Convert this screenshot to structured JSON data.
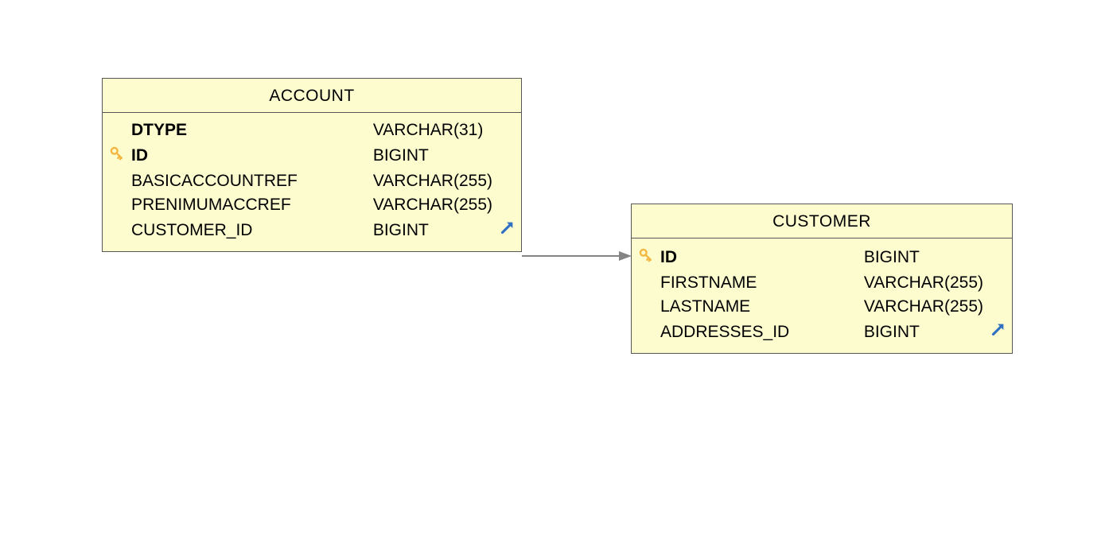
{
  "entities": {
    "account": {
      "title": "ACCOUNT",
      "columns": [
        {
          "name": "DTYPE",
          "type": "VARCHAR(31)",
          "pk": false,
          "fk": false,
          "bold": true
        },
        {
          "name": "ID",
          "type": "BIGINT",
          "pk": true,
          "fk": false,
          "bold": true
        },
        {
          "name": "BASICACCOUNTREF",
          "type": "VARCHAR(255)",
          "pk": false,
          "fk": false,
          "bold": false
        },
        {
          "name": "PRENIMUMACCREF",
          "type": "VARCHAR(255)",
          "pk": false,
          "fk": false,
          "bold": false
        },
        {
          "name": "CUSTOMER_ID",
          "type": "BIGINT",
          "pk": false,
          "fk": true,
          "bold": false
        }
      ]
    },
    "customer": {
      "title": "CUSTOMER",
      "columns": [
        {
          "name": "ID",
          "type": "BIGINT",
          "pk": true,
          "fk": false,
          "bold": true
        },
        {
          "name": "FIRSTNAME",
          "type": "VARCHAR(255)",
          "pk": false,
          "fk": false,
          "bold": false
        },
        {
          "name": "LASTNAME",
          "type": "VARCHAR(255)",
          "pk": false,
          "fk": false,
          "bold": false
        },
        {
          "name": "ADDRESSES_ID",
          "type": "BIGINT",
          "pk": false,
          "fk": true,
          "bold": false
        }
      ]
    }
  },
  "relationships": [
    {
      "from": "account.CUSTOMER_ID",
      "to": "customer.ID"
    }
  ]
}
